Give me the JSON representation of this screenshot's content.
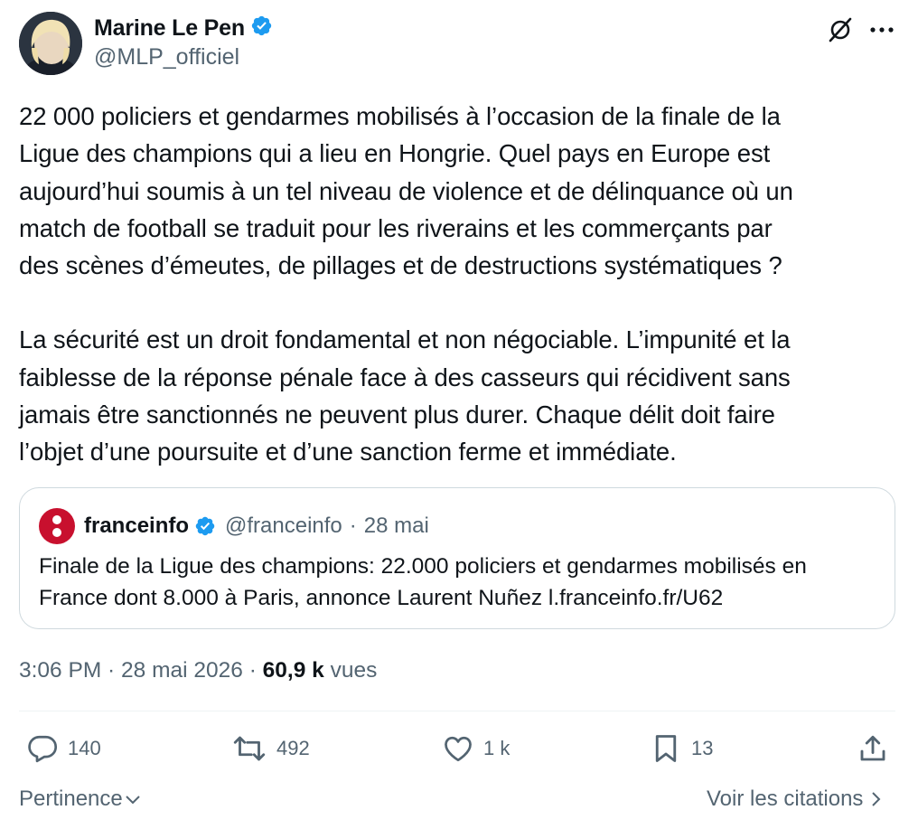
{
  "author": {
    "name": "Marine Le Pen",
    "handle": "@MLP_officiel",
    "verified": true
  },
  "tweet": {
    "paragraph1": "22 000 policiers et gendarmes mobilisés à l’occasion de la finale de la\nLigue des champions qui a lieu en Hongrie. Quel pays en Europe est\naujourd’hui soumis à un tel niveau de violence et de délinquance où un\nmatch de football se traduit pour les riverains et les commerçants par\ndes scènes d’émeutes, de pillages et de destructions systématiques ?",
    "paragraph2": "La sécurité est un droit fondamental et non négociable. L’impunité et la\nfaiblesse de la réponse pénale face à des casseurs qui récidivent sans\njamais être sanctionnés ne peuvent plus durer. Chaque délit doit faire\nl’objet d’une poursuite et d’une  sanction ferme et immédiate."
  },
  "quote": {
    "name": "franceinfo",
    "handle": "@franceinfo",
    "separator": "·",
    "date": "28 mai",
    "text": "Finale de la Ligue des champions: 22.000 policiers et gendarmes mobilisés en\nFrance dont 8.000 à Paris, annonce Laurent Nuñez l.franceinfo.fr/U62"
  },
  "meta": {
    "time": "3:06 PM",
    "sep1": " · ",
    "date": "28 mai 2026",
    "sep2": " · ",
    "views_count": "60,9 k",
    "views_label": " vues"
  },
  "actions": {
    "replies": "140",
    "reposts": "492",
    "likes": "1 k",
    "bookmarks": "13"
  },
  "footer": {
    "sort_label": "Pertinence",
    "quotes_label": "Voir les citations"
  },
  "icons": {
    "verified": "verified-badge-icon",
    "grok": "grok-icon",
    "more": "more-dots-icon",
    "reply": "reply-icon",
    "repost": "repost-icon",
    "like": "heart-icon",
    "bookmark": "bookmark-icon",
    "share": "share-icon"
  },
  "colors": {
    "verified": "#1d9bf0",
    "text": "#0f1419",
    "secondary": "#536471",
    "border": "#cfd9de",
    "franceinfo": "#c8102e"
  }
}
